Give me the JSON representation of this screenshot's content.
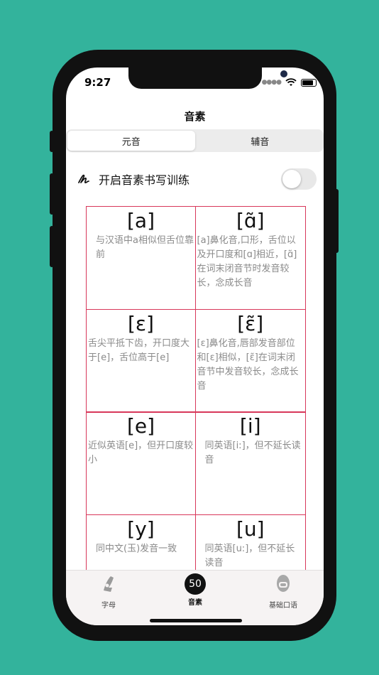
{
  "status_bar": {
    "time": "9:27"
  },
  "nav": {
    "title": "音素"
  },
  "segments": [
    {
      "label": "元音",
      "active": true
    },
    {
      "label": "辅音",
      "active": false
    }
  ],
  "writing_toggle": {
    "label": "开启音素书写训练",
    "enabled": false,
    "icon": "pen-scribble-icon"
  },
  "phonemes": [
    {
      "symbol": "[a]",
      "description": "与汉语中a相似但舌位靠前"
    },
    {
      "symbol": "[ɑ̃]",
      "description": "[a]鼻化音,口形，舌位以及开口度和[ɑ]相近，[ɑ̃]在词末闭音节时发音较长，念成长音"
    },
    {
      "symbol": "[ɛ]",
      "description": "舌尖平抵下齿，开口度大于[e]，舌位高于[e]"
    },
    {
      "symbol": "[ɛ̃]",
      "description": "[ɛ]鼻化音,唇部发音部位和[ɛ]相似，[ɛ̃]在词末闭音节中发音较长，念成长音"
    },
    {
      "symbol": "[e]",
      "description": "近似英语[e]，但开口度较小"
    },
    {
      "symbol": "[i]",
      "description": "同英语[i:]，但不延长读音"
    },
    {
      "symbol": "[y]",
      "description": "同中文(玉)发音一致"
    },
    {
      "symbol": "[u]",
      "description": "同英语[u:]，但不延长读音"
    }
  ],
  "tabbar": {
    "tabs": [
      {
        "label": "字母",
        "icon": "letter-icon"
      },
      {
        "label": "音素",
        "badge": "50",
        "active": true
      },
      {
        "label": "基础口语",
        "icon": "speaking-icon"
      }
    ]
  },
  "colors": {
    "background": "#33b39c",
    "grid_border": "#d8375a",
    "description_text": "#8a8a8a"
  }
}
